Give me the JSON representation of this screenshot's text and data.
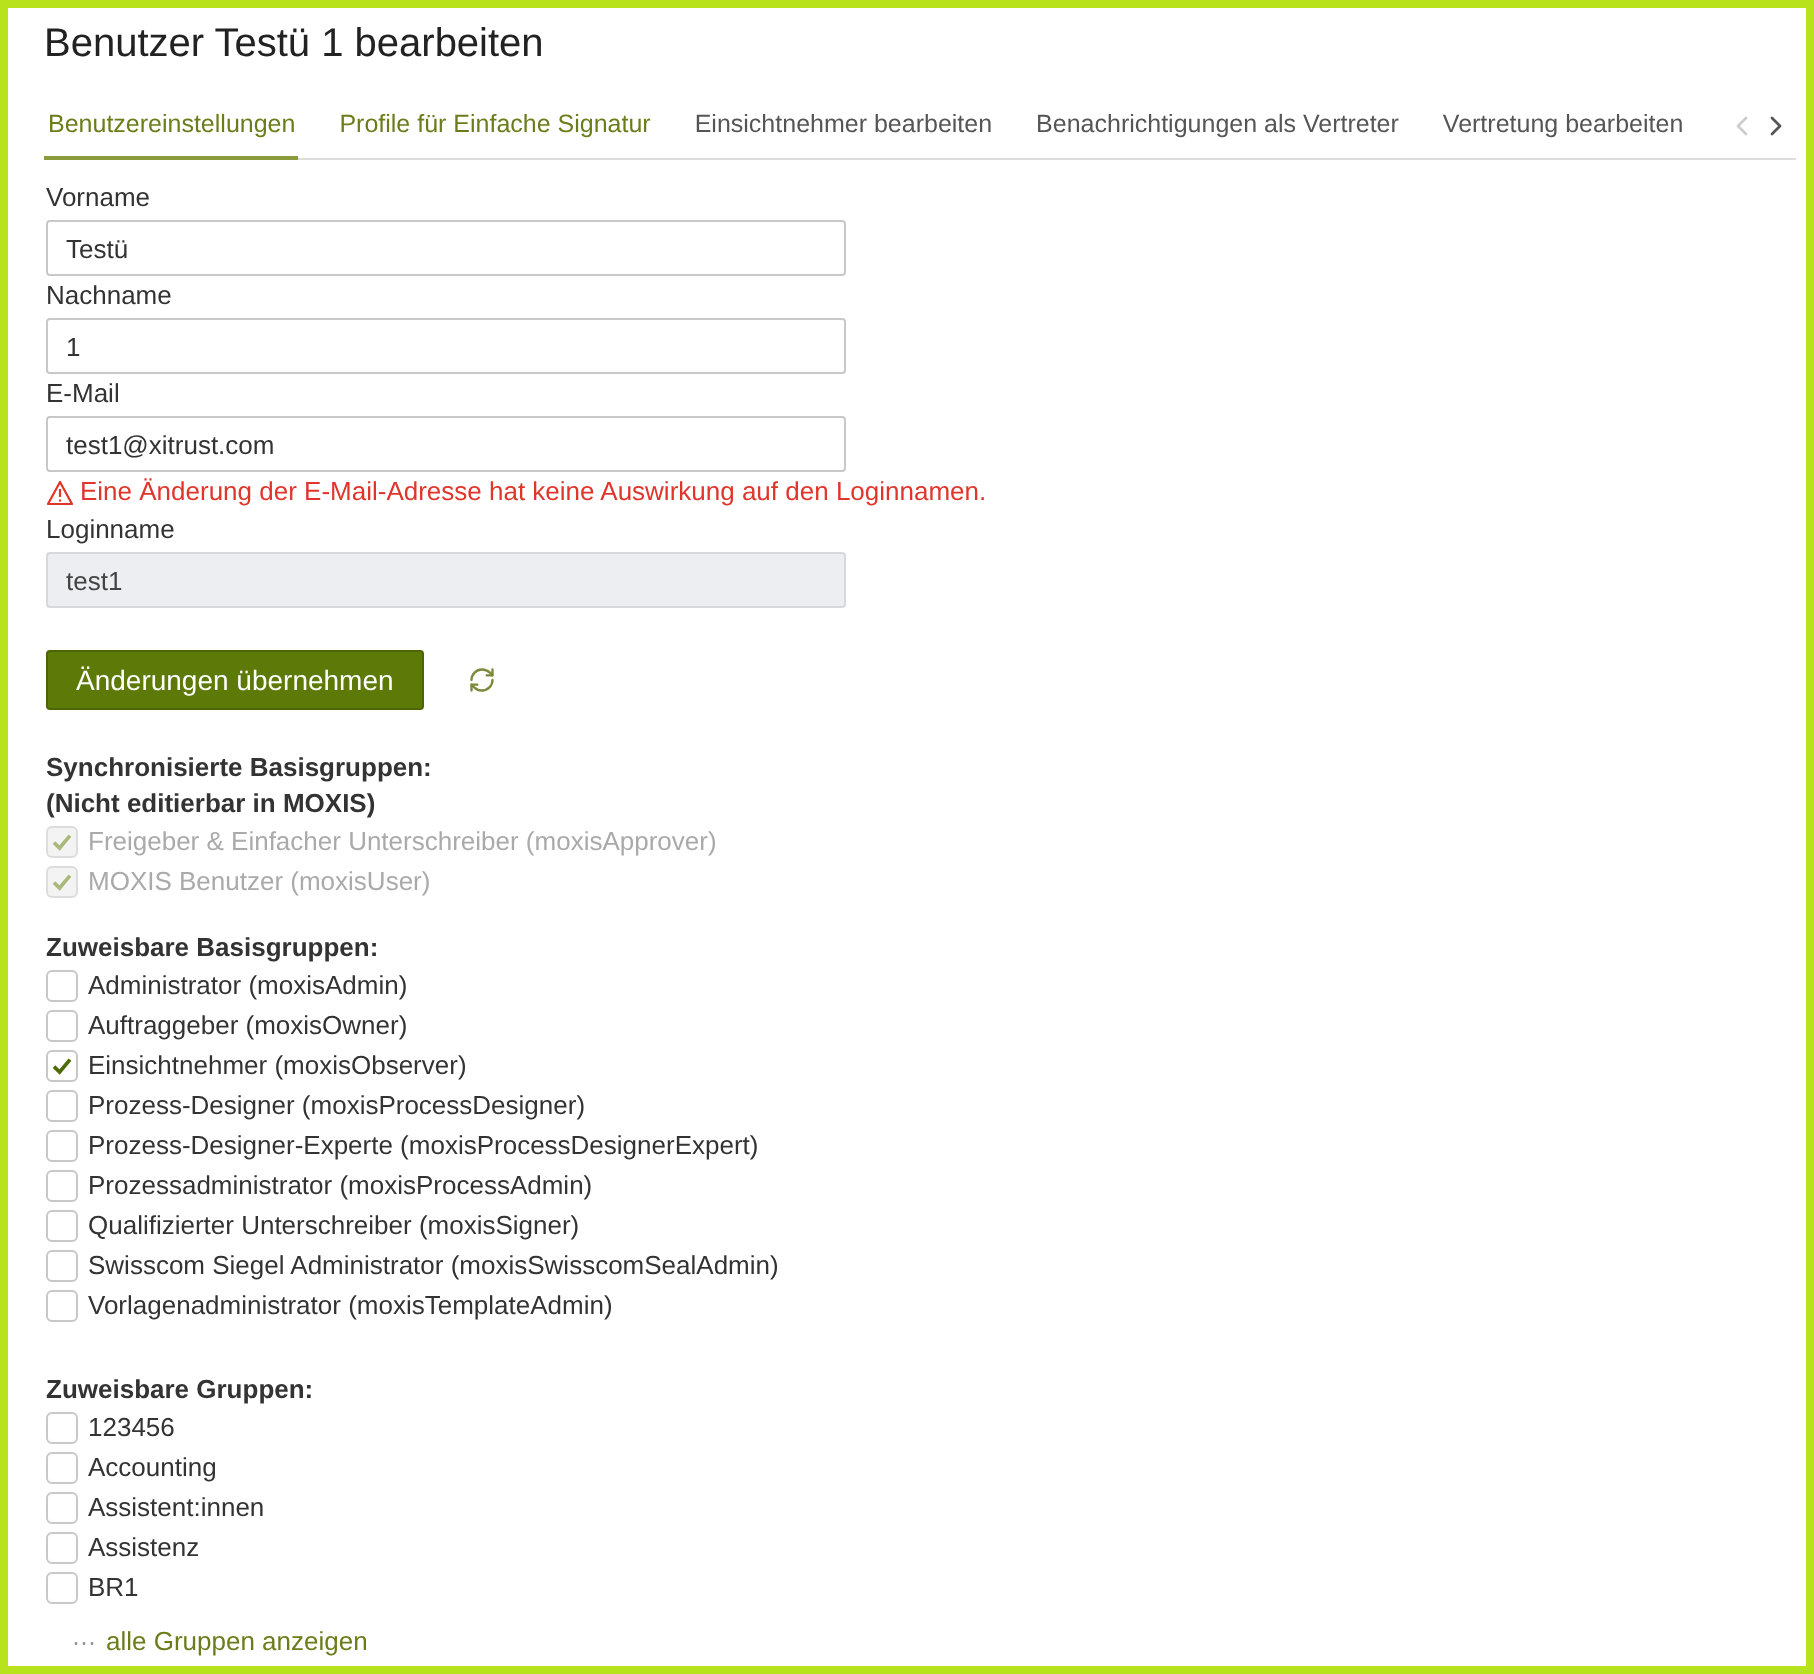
{
  "title": "Benutzer Testü 1 bearbeiten",
  "tabs": [
    {
      "label": "Benutzereinstellungen",
      "selected": true,
      "hovered": false
    },
    {
      "label": "Profile für Einfache Signatur",
      "selected": false,
      "hovered": true
    },
    {
      "label": "Einsichtnehmer bearbeiten",
      "selected": false,
      "hovered": false
    },
    {
      "label": "Benachrichtigungen als Vertreter",
      "selected": false,
      "hovered": false
    },
    {
      "label": "Vertretung bearbeiten",
      "selected": false,
      "hovered": false
    }
  ],
  "tab_scroll": {
    "prev_disabled": true,
    "next_disabled": false
  },
  "fields": [
    {
      "label": "Vorname",
      "value": "Testü",
      "disabled": false
    },
    {
      "label": "Nachname",
      "value": "1",
      "disabled": false
    },
    {
      "label": "E-Mail",
      "value": "test1@xitrust.com",
      "disabled": false,
      "warning": "Eine Änderung der E-Mail-Adresse hat keine Auswirkung auf den Loginnamen."
    },
    {
      "label": "Loginname",
      "value": "test1",
      "disabled": true
    }
  ],
  "save_button": "Änderungen übernehmen",
  "groups": [
    {
      "heading": [
        "Synchronisierte Basisgruppen:",
        "(Nicht editierbar in MOXIS)"
      ],
      "items": [
        {
          "label": "Freigeber & Einfacher Unterschreiber (moxisApprover)",
          "checked": true,
          "disabled": true
        },
        {
          "label": "MOXIS Benutzer (moxisUser)",
          "checked": true,
          "disabled": true
        }
      ]
    },
    {
      "heading": [
        "Zuweisbare Basisgruppen:"
      ],
      "items": [
        {
          "label": "Administrator (moxisAdmin)",
          "checked": false,
          "disabled": false
        },
        {
          "label": "Auftraggeber (moxisOwner)",
          "checked": false,
          "disabled": false
        },
        {
          "label": "Einsichtnehmer (moxisObserver)",
          "checked": true,
          "disabled": false
        },
        {
          "label": "Prozess-Designer (moxisProcessDesigner)",
          "checked": false,
          "disabled": false
        },
        {
          "label": "Prozess-Designer-Experte (moxisProcessDesignerExpert)",
          "checked": false,
          "disabled": false
        },
        {
          "label": "Prozessadministrator (moxisProcessAdmin)",
          "checked": false,
          "disabled": false
        },
        {
          "label": "Qualifizierter Unterschreiber (moxisSigner)",
          "checked": false,
          "disabled": false
        },
        {
          "label": "Swisscom Siegel Administrator (moxisSwisscomSealAdmin)",
          "checked": false,
          "disabled": false
        },
        {
          "label": "Vorlagenadministrator (moxisTemplateAdmin)",
          "checked": false,
          "disabled": false
        }
      ]
    },
    {
      "heading": [
        "Zuweisbare Gruppen:"
      ],
      "items": [
        {
          "label": "123456",
          "checked": false,
          "disabled": false
        },
        {
          "label": "Accounting",
          "checked": false,
          "disabled": false
        },
        {
          "label": "Assistent:innen",
          "checked": false,
          "disabled": false
        },
        {
          "label": "Assistenz",
          "checked": false,
          "disabled": false
        },
        {
          "label": "BR1",
          "checked": false,
          "disabled": false
        }
      ],
      "more_link": {
        "icon": "···",
        "label": "alle Gruppen anzeigen"
      }
    }
  ]
}
